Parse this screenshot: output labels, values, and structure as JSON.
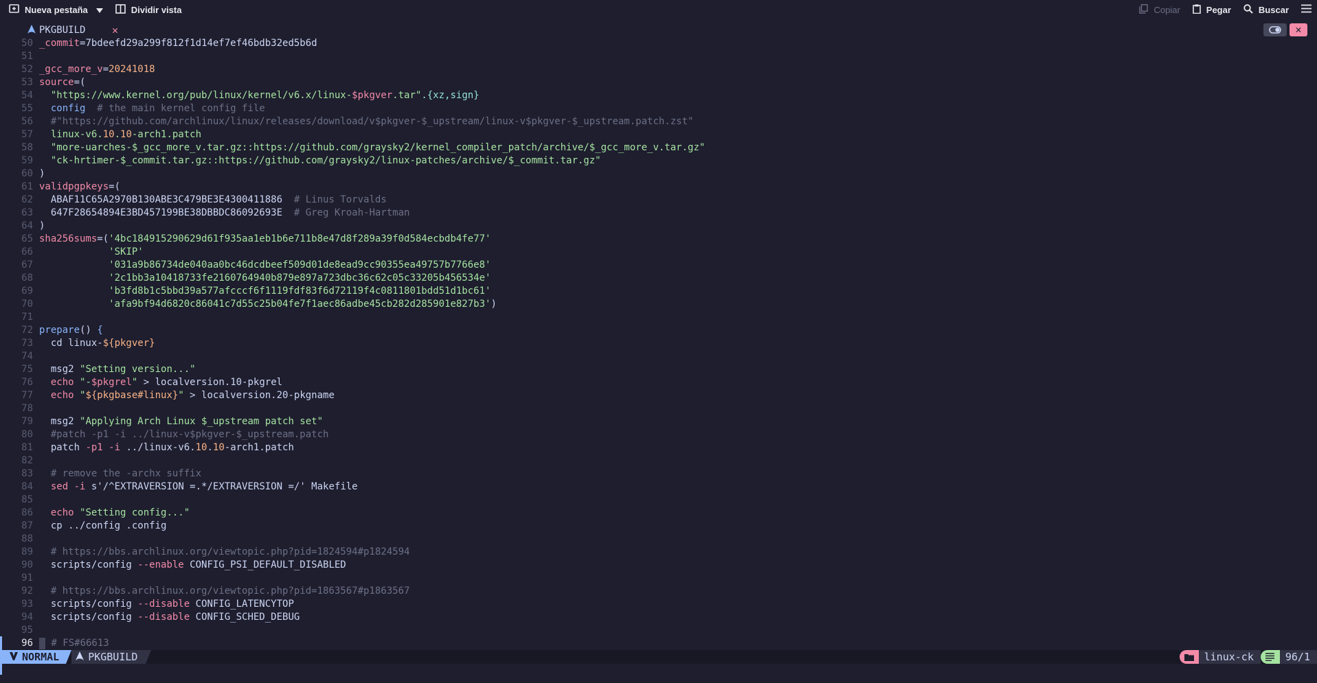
{
  "toolbar": {
    "new_tab_label": "Nueva pestaña",
    "split_label": "Dividir vista",
    "copy_label": "Copiar",
    "paste_label": "Pegar",
    "search_label": "Buscar"
  },
  "tab": {
    "title": "PKGBUILD",
    "close_glyph": "✕"
  },
  "editor": {
    "lines": [
      {
        "n": "50",
        "segs": [
          [
            "var",
            "_commit"
          ],
          [
            "txt",
            "=7bdeefd29a299f812f1d14ef7ef46bdb32ed5b6d"
          ]
        ]
      },
      {
        "n": "51",
        "segs": []
      },
      {
        "n": "52",
        "segs": [
          [
            "var",
            "_gcc_more_v"
          ],
          [
            "txt",
            "="
          ],
          [
            "num",
            "20241018"
          ]
        ]
      },
      {
        "n": "53",
        "segs": [
          [
            "var",
            "source"
          ],
          [
            "txt",
            "=("
          ]
        ]
      },
      {
        "n": "54",
        "segs": [
          [
            "txt",
            "  "
          ],
          [
            "str",
            "\"https://www.kernel.org/pub/linux/kernel/v6.x/linux-"
          ],
          [
            "var",
            "$pkgver"
          ],
          [
            "str",
            ".tar\""
          ],
          [
            "cyan",
            ".{xz,sign}"
          ]
        ]
      },
      {
        "n": "55",
        "segs": [
          [
            "txt",
            "  "
          ],
          [
            "fn",
            "config"
          ],
          [
            "cmt",
            "  # the main kernel config file"
          ]
        ]
      },
      {
        "n": "56",
        "segs": [
          [
            "cmt",
            "  #\"https://github.com/archlinux/linux/releases/download/v$pkgver-$_upstream/linux-v$pkgver-$_upstream.patch.zst\""
          ]
        ]
      },
      {
        "n": "57",
        "segs": [
          [
            "txt",
            "  "
          ],
          [
            "str",
            "linux-v6."
          ],
          [
            "num",
            "10"
          ],
          [
            "str",
            "."
          ],
          [
            "num",
            "10"
          ],
          [
            "str",
            "-arch1.patch"
          ]
        ]
      },
      {
        "n": "58",
        "segs": [
          [
            "txt",
            "  "
          ],
          [
            "str",
            "\"more-uarches-$_gcc_more_v.tar.gz::https://github.com/graysky2/kernel_compiler_patch/archive/$_gcc_more_v.tar.gz\""
          ]
        ]
      },
      {
        "n": "59",
        "segs": [
          [
            "txt",
            "  "
          ],
          [
            "str",
            "\"ck-hrtimer-$_commit.tar.gz::https://github.com/graysky2/linux-patches/archive/$_commit.tar.gz\""
          ]
        ]
      },
      {
        "n": "60",
        "segs": [
          [
            "txt",
            ")"
          ]
        ]
      },
      {
        "n": "61",
        "segs": [
          [
            "var",
            "validpgpkeys"
          ],
          [
            "txt",
            "=("
          ]
        ]
      },
      {
        "n": "62",
        "segs": [
          [
            "txt",
            "  ABAF11C65A2970B130ABE3C479BE3E4300411886"
          ],
          [
            "cmt",
            "  # Linus Torvalds"
          ]
        ]
      },
      {
        "n": "63",
        "segs": [
          [
            "txt",
            "  647F28654894E3BD457199BE38DBBDC86092693E"
          ],
          [
            "cmt",
            "  # Greg Kroah-Hartman"
          ]
        ]
      },
      {
        "n": "64",
        "segs": [
          [
            "txt",
            ")"
          ]
        ]
      },
      {
        "n": "65",
        "segs": [
          [
            "var",
            "sha256sums"
          ],
          [
            "txt",
            "=("
          ],
          [
            "str",
            "'4bc184915290629d61f935aa1eb1b6e711b8e47d8f289a39f0d584ecbdb4fe77'"
          ]
        ]
      },
      {
        "n": "66",
        "segs": [
          [
            "txt",
            "            "
          ],
          [
            "str",
            "'SKIP'"
          ]
        ]
      },
      {
        "n": "67",
        "segs": [
          [
            "txt",
            "            "
          ],
          [
            "str",
            "'031a9b86734de040aa0bc46dcdbeef509d01de8ead9cc90355ea49757b7766e8'"
          ]
        ]
      },
      {
        "n": "68",
        "segs": [
          [
            "txt",
            "            "
          ],
          [
            "str",
            "'2c1bb3a10418733fe2160764940b879e897a723dbc36c62c05c33205b456534e'"
          ]
        ]
      },
      {
        "n": "69",
        "segs": [
          [
            "txt",
            "            "
          ],
          [
            "str",
            "'b3fd8b1c5bbd39a577afcccf6f1119fdf83f6d72119f4c0811801bdd51d1bc61'"
          ]
        ]
      },
      {
        "n": "70",
        "segs": [
          [
            "txt",
            "            "
          ],
          [
            "str",
            "'afa9bf94d6820c86041c7d55c25b04fe7f1aec86adbe45cb282d285901e827b3'"
          ],
          [
            "txt",
            ")"
          ]
        ]
      },
      {
        "n": "71",
        "segs": []
      },
      {
        "n": "72",
        "segs": [
          [
            "fn",
            "prepare"
          ],
          [
            "txt",
            "() "
          ],
          [
            "fn",
            "{"
          ]
        ]
      },
      {
        "n": "73",
        "segs": [
          [
            "txt",
            "  "
          ],
          [
            "txt",
            "cd linux-"
          ],
          [
            "num",
            "${pkgver}"
          ]
        ]
      },
      {
        "n": "74",
        "segs": []
      },
      {
        "n": "75",
        "segs": [
          [
            "txt",
            "  msg2 "
          ],
          [
            "str",
            "\"Setting version...\""
          ]
        ]
      },
      {
        "n": "76",
        "segs": [
          [
            "txt",
            "  "
          ],
          [
            "var",
            "echo"
          ],
          [
            "txt",
            " "
          ],
          [
            "str",
            "\"-"
          ],
          [
            "var",
            "$pkgrel"
          ],
          [
            "str",
            "\""
          ],
          [
            "txt",
            " > localversion.10-pkgrel"
          ]
        ]
      },
      {
        "n": "77",
        "segs": [
          [
            "txt",
            "  "
          ],
          [
            "var",
            "echo"
          ],
          [
            "txt",
            " "
          ],
          [
            "str",
            "\""
          ],
          [
            "num",
            "${pkgbase#linux}"
          ],
          [
            "str",
            "\""
          ],
          [
            "txt",
            " > localversion.20-pkgname"
          ]
        ]
      },
      {
        "n": "78",
        "segs": []
      },
      {
        "n": "79",
        "segs": [
          [
            "txt",
            "  msg2 "
          ],
          [
            "str",
            "\"Applying Arch Linux $_upstream patch set\""
          ]
        ]
      },
      {
        "n": "80",
        "segs": [
          [
            "cmt",
            "  #patch -p1 -i ../linux-v$pkgver-$_upstream.patch"
          ]
        ]
      },
      {
        "n": "81",
        "segs": [
          [
            "txt",
            "  patch "
          ],
          [
            "var",
            "-p1"
          ],
          [
            "txt",
            " "
          ],
          [
            "var",
            "-i"
          ],
          [
            "txt",
            " ../linux-v6."
          ],
          [
            "num",
            "10"
          ],
          [
            "txt",
            "."
          ],
          [
            "num",
            "10"
          ],
          [
            "txt",
            "-arch1.patch"
          ]
        ]
      },
      {
        "n": "82",
        "segs": []
      },
      {
        "n": "83",
        "segs": [
          [
            "cmt",
            "  # remove the -archx suffix"
          ]
        ]
      },
      {
        "n": "84",
        "segs": [
          [
            "txt",
            "  "
          ],
          [
            "var",
            "sed"
          ],
          [
            "txt",
            " "
          ],
          [
            "var",
            "-i"
          ],
          [
            "txt",
            " s'/^EXTRAVERSION =.*/EXTRAVERSION =/' Makefile"
          ]
        ]
      },
      {
        "n": "85",
        "segs": []
      },
      {
        "n": "86",
        "segs": [
          [
            "txt",
            "  "
          ],
          [
            "var",
            "echo"
          ],
          [
            "txt",
            " "
          ],
          [
            "str",
            "\"Setting config...\""
          ]
        ]
      },
      {
        "n": "87",
        "segs": [
          [
            "txt",
            "  cp ../config .config"
          ]
        ]
      },
      {
        "n": "88",
        "segs": []
      },
      {
        "n": "89",
        "segs": [
          [
            "cmt",
            "  # https://bbs.archlinux.org/viewtopic.php?pid=1824594#p1824594"
          ]
        ]
      },
      {
        "n": "90",
        "segs": [
          [
            "txt",
            "  scripts/config "
          ],
          [
            "var",
            "--enable"
          ],
          [
            "txt",
            " CONFIG_PSI_DEFAULT_DISABLED"
          ]
        ]
      },
      {
        "n": "91",
        "segs": []
      },
      {
        "n": "92",
        "segs": [
          [
            "cmt",
            "  # https://bbs.archlinux.org/viewtopic.php?pid=1863567#p1863567"
          ]
        ]
      },
      {
        "n": "93",
        "segs": [
          [
            "txt",
            "  scripts/config "
          ],
          [
            "var",
            "--disable"
          ],
          [
            "txt",
            " CONFIG_LATENCYTOP"
          ]
        ]
      },
      {
        "n": "94",
        "segs": [
          [
            "txt",
            "  scripts/config "
          ],
          [
            "var",
            "--disable"
          ],
          [
            "txt",
            " CONFIG_SCHED_DEBUG"
          ]
        ]
      },
      {
        "n": "95",
        "segs": []
      },
      {
        "n": "96",
        "segs": [
          [
            "cursor",
            ""
          ],
          [
            "cmt",
            " # FS#66613"
          ]
        ],
        "current": true
      }
    ]
  },
  "statusline": {
    "mode": "NORMAL",
    "file": "PKGBUILD",
    "branch": "linux-ck",
    "position": "96/1"
  },
  "colors": {
    "accent": "#89b4fa",
    "close": "#f38ba8",
    "folder_pill": "#f38ba8",
    "position_pill": "#a6e3a1"
  }
}
